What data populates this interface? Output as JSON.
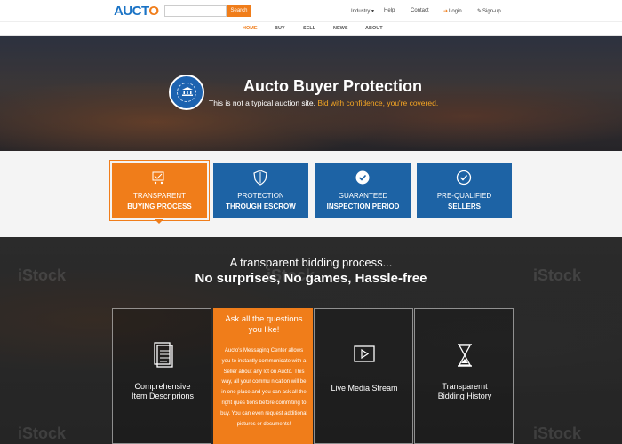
{
  "header": {
    "logo": {
      "prefix": "AUCT",
      "suffix": "O"
    },
    "search": {
      "placeholder": "",
      "button_label": "Search"
    },
    "nav": [
      {
        "label": "Industry ▾"
      },
      {
        "label": "Help"
      },
      {
        "label": "Contact"
      },
      {
        "label": "Login",
        "icon": "login-icon"
      },
      {
        "label": "Sign-up",
        "icon": "edit-icon"
      }
    ]
  },
  "main_nav": {
    "items": [
      {
        "label": "HOME",
        "active": true
      },
      {
        "label": "BUY"
      },
      {
        "label": "SELL"
      },
      {
        "label": "NEWS"
      },
      {
        "label": "ABOUT"
      }
    ]
  },
  "hero": {
    "title": "Aucto Buyer Protection",
    "subtitle_plain": "This is not a typical auction site. ",
    "subtitle_highlight": "Bid with confidence, you're covered."
  },
  "features": [
    {
      "line1": "TRANSPARENT",
      "line2": "BUYING PROCESS",
      "icon": "cart-icon",
      "active": true
    },
    {
      "line1": "PROTECTION",
      "line2": "THROUGH ESCROW",
      "icon": "shield-icon"
    },
    {
      "line1": "GUARANTEED",
      "line2": "INSPECTION PERIOD",
      "icon": "badge-check-icon"
    },
    {
      "line1": "PRE-QUALIFIED",
      "line2": "SELLERS",
      "icon": "check-circle-icon"
    }
  ],
  "lower": {
    "subtitle": "A transparent bidding process...",
    "title": "No surprises, No games, Hassle-free",
    "cards": [
      {
        "line1": "Comprehensive",
        "line2": "Item Descriprions",
        "icon": "document-icon"
      },
      {
        "title": "Ask all the questions you like!",
        "body": "Aucto's Messaging Center allows you to instantly communicate with a Seller about any lot on Aucto. This way, all your commu nication will be in one place and you can ask all the right ques tions before commiting to buy. You can even request additional pictures or documents!"
      },
      {
        "line1": "Live Media Stream",
        "icon": "play-icon"
      },
      {
        "line1": "Transparernt",
        "line2": "Bidding History",
        "icon": "hourglass-icon"
      }
    ],
    "watermark": "iStock"
  },
  "colors": {
    "accent": "#f07d1a",
    "primary": "#1d63a5"
  }
}
